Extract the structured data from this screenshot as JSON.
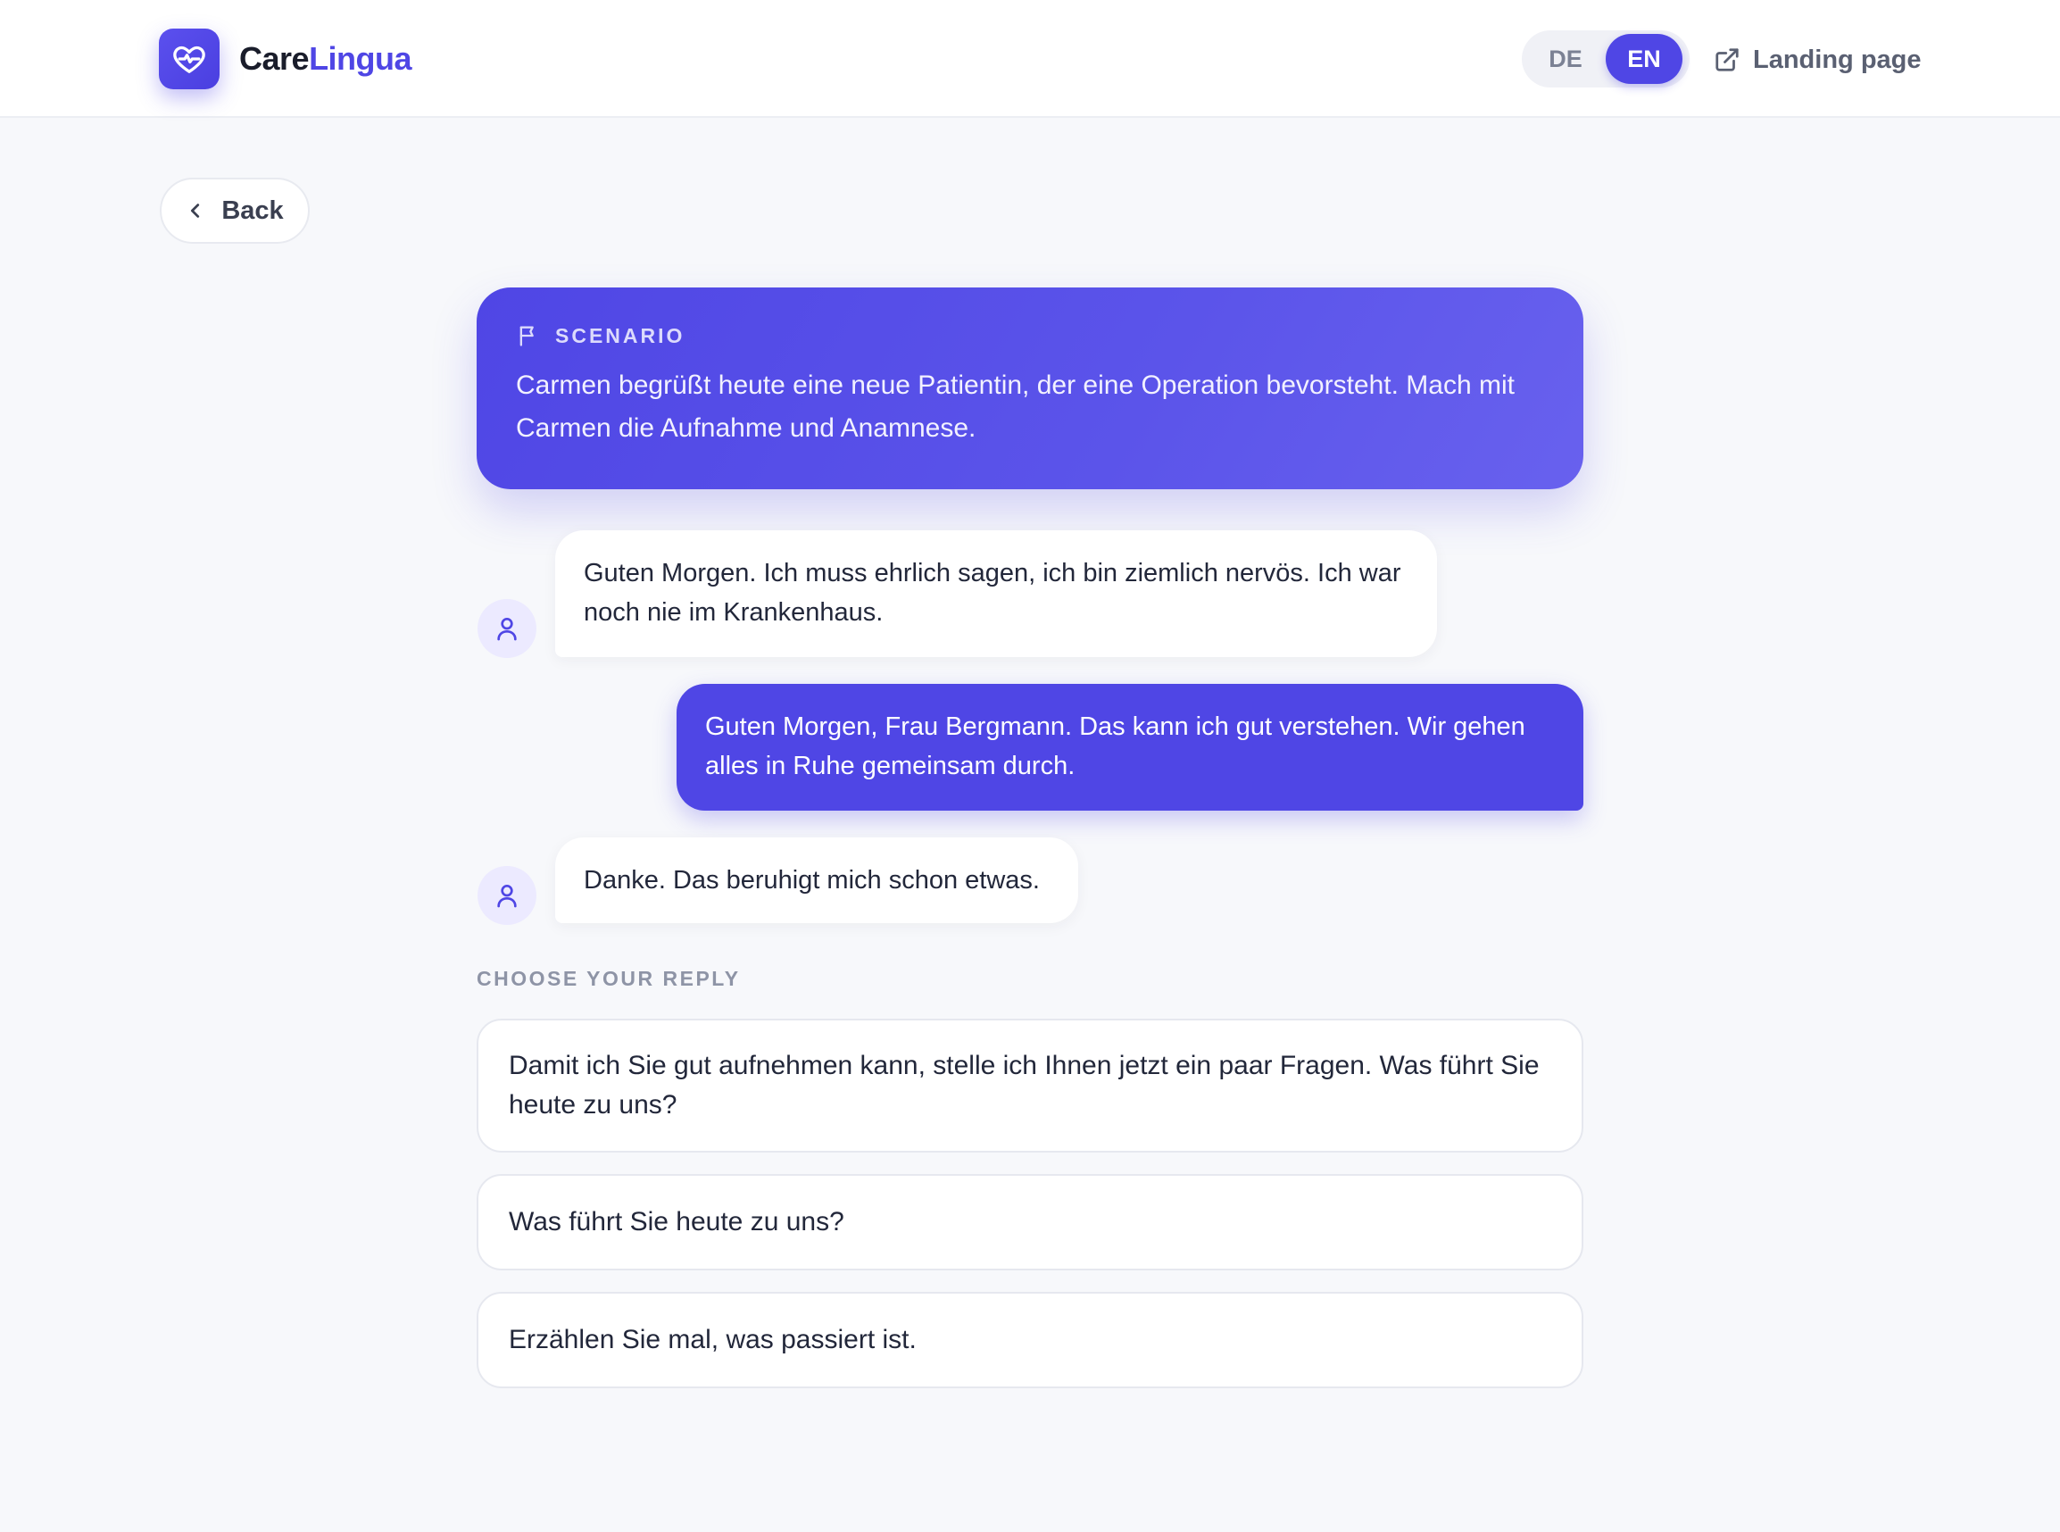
{
  "header": {
    "brand_part1": "Care",
    "brand_part2": "Lingua",
    "logo_icon": "heart-pulse-icon",
    "languages": [
      {
        "code": "DE",
        "active": false
      },
      {
        "code": "EN",
        "active": true
      }
    ],
    "landing_link_label": "Landing page",
    "landing_link_icon": "external-link-icon"
  },
  "back_label": "Back",
  "scenario": {
    "label": "SCENARIO",
    "icon": "flag-icon",
    "text": "Carmen begrüßt heute eine neue Patientin, der eine Operation bevorsteht. Mach mit Carmen die Aufnahme und Anamnese."
  },
  "messages": [
    {
      "from": "patient",
      "text": "Guten Morgen. Ich muss ehrlich sagen, ich bin ziemlich nervös. Ich war noch nie im Krankenhaus."
    },
    {
      "from": "nurse",
      "text": "Guten Morgen, Frau Bergmann. Das kann ich gut verstehen. Wir gehen alles in Ruhe gemeinsam durch."
    },
    {
      "from": "patient",
      "text": "Danke. Das beruhigt mich schon etwas."
    }
  ],
  "choose_label": "CHOOSE YOUR REPLY",
  "options": [
    {
      "text": "Damit ich Sie gut aufnehmen kann, stelle ich Ihnen jetzt ein paar Fragen. Was führt Sie heute zu uns?"
    },
    {
      "text": "Was führt Sie heute zu uns?"
    },
    {
      "text": "Erzählen Sie mal, was passiert ist."
    }
  ],
  "colors": {
    "accent": "#4f46e5",
    "background": "#f7f8fb",
    "avatar_bg": "#eceaff"
  }
}
